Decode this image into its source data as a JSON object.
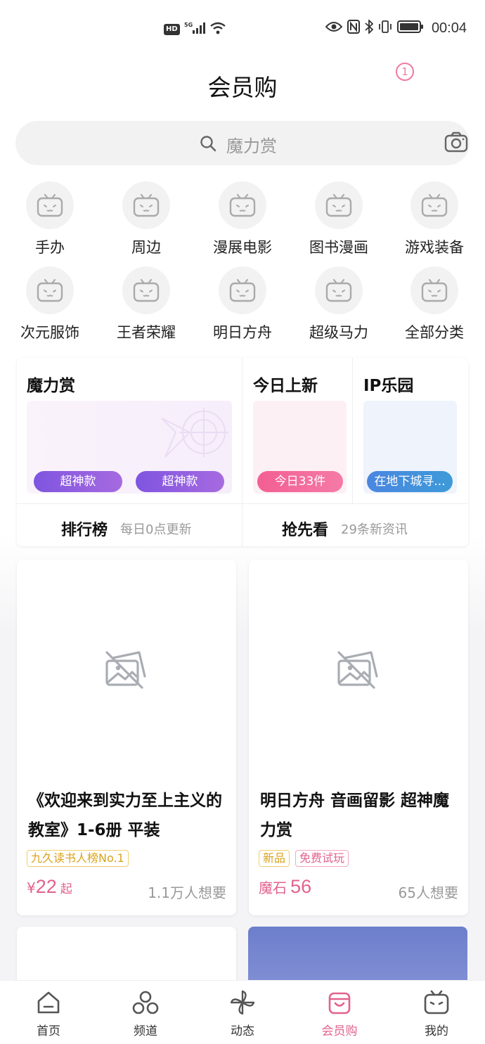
{
  "status_bar": {
    "hd": "HD",
    "network": "5G",
    "time": "00:04"
  },
  "header": {
    "title": "会员购",
    "notification_count": "1"
  },
  "search": {
    "placeholder": "魔力赏"
  },
  "categories": [
    {
      "label": "手办"
    },
    {
      "label": "周边"
    },
    {
      "label": "漫展电影"
    },
    {
      "label": "图书漫画"
    },
    {
      "label": "游戏装备"
    },
    {
      "label": "次元服饰"
    },
    {
      "label": "王者荣耀"
    },
    {
      "label": "明日方舟"
    },
    {
      "label": "超级马力"
    },
    {
      "label": "全部分类"
    }
  ],
  "promo": {
    "moli": {
      "title": "魔力赏",
      "pill_1": "超神款",
      "pill_2": "超神款"
    },
    "today": {
      "title": "今日上新",
      "pill": "今日33件"
    },
    "ip": {
      "title": "IP乐园",
      "pill": "在地下城寻..."
    },
    "ranking": {
      "label": "排行榜",
      "sub": "每日0点更新"
    },
    "preview": {
      "label": "抢先看",
      "sub": "29条新资讯"
    }
  },
  "products": [
    {
      "title": "《欢迎来到实力至上主义的教室》1-6册 平装",
      "tags": [
        "九久读书人榜No.1"
      ],
      "price_prefix": "¥",
      "price": "22",
      "price_suffix": "起",
      "want": "1.1万人想要"
    },
    {
      "title": "明日方舟 音画留影 超神魔力赏",
      "tags": [
        "新品",
        "免费试玩"
      ],
      "price_prefix": "魔石",
      "price": "56",
      "price_suffix": "",
      "want": "65人想要"
    }
  ],
  "bottom_nav": [
    {
      "label": "首页",
      "icon": "home-icon"
    },
    {
      "label": "频道",
      "icon": "channel-icon"
    },
    {
      "label": "动态",
      "icon": "pinwheel-icon"
    },
    {
      "label": "会员购",
      "icon": "shopping-bag-icon",
      "active": true
    },
    {
      "label": "我的",
      "icon": "tv-icon"
    }
  ],
  "colors": {
    "accent": "#e2628c",
    "purple_pill": "#8a4fe0",
    "pink_pill": "#f0578f",
    "blue_pill": "#3f8fe0",
    "partial_card": "#7081cb"
  }
}
